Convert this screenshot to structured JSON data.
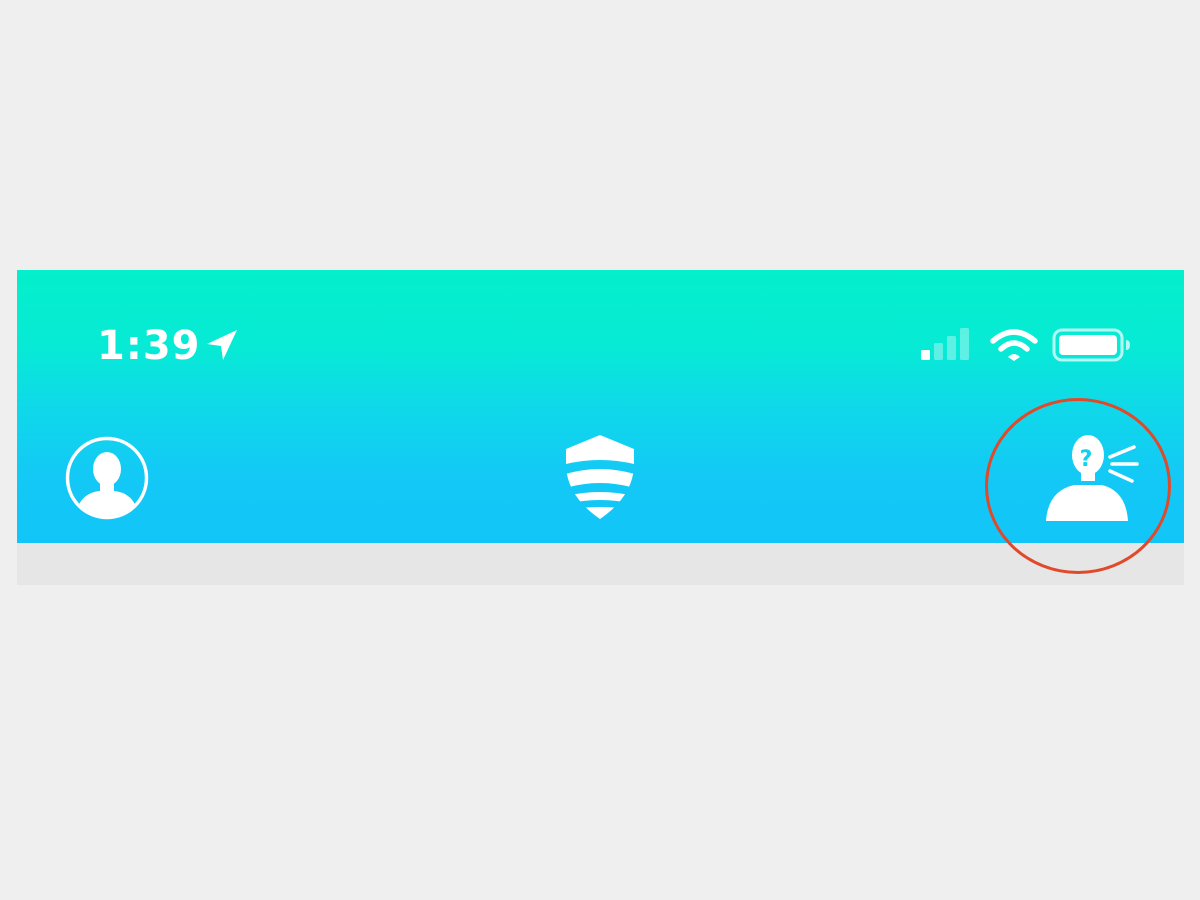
{
  "status_bar": {
    "time": "1:39",
    "location_icon": "location-arrow-icon",
    "signal_icon": "cellular-signal-icon",
    "signal_bars_active": 1,
    "signal_bars_total": 4,
    "wifi_icon": "wifi-icon",
    "battery_icon": "battery-icon",
    "battery_level": 0.95
  },
  "nav_bar": {
    "left_icon": "profile-avatar-icon",
    "center_icon": "shield-logo-icon",
    "right_icon": "help-speaking-person-icon"
  },
  "highlight": {
    "target": "help-speaking-person-icon",
    "color": "#e04a2a"
  },
  "colors": {
    "header_top": "#04efcb",
    "header_bottom": "#12c5f8",
    "icon": "#ffffff",
    "page_background": "#efefef"
  }
}
